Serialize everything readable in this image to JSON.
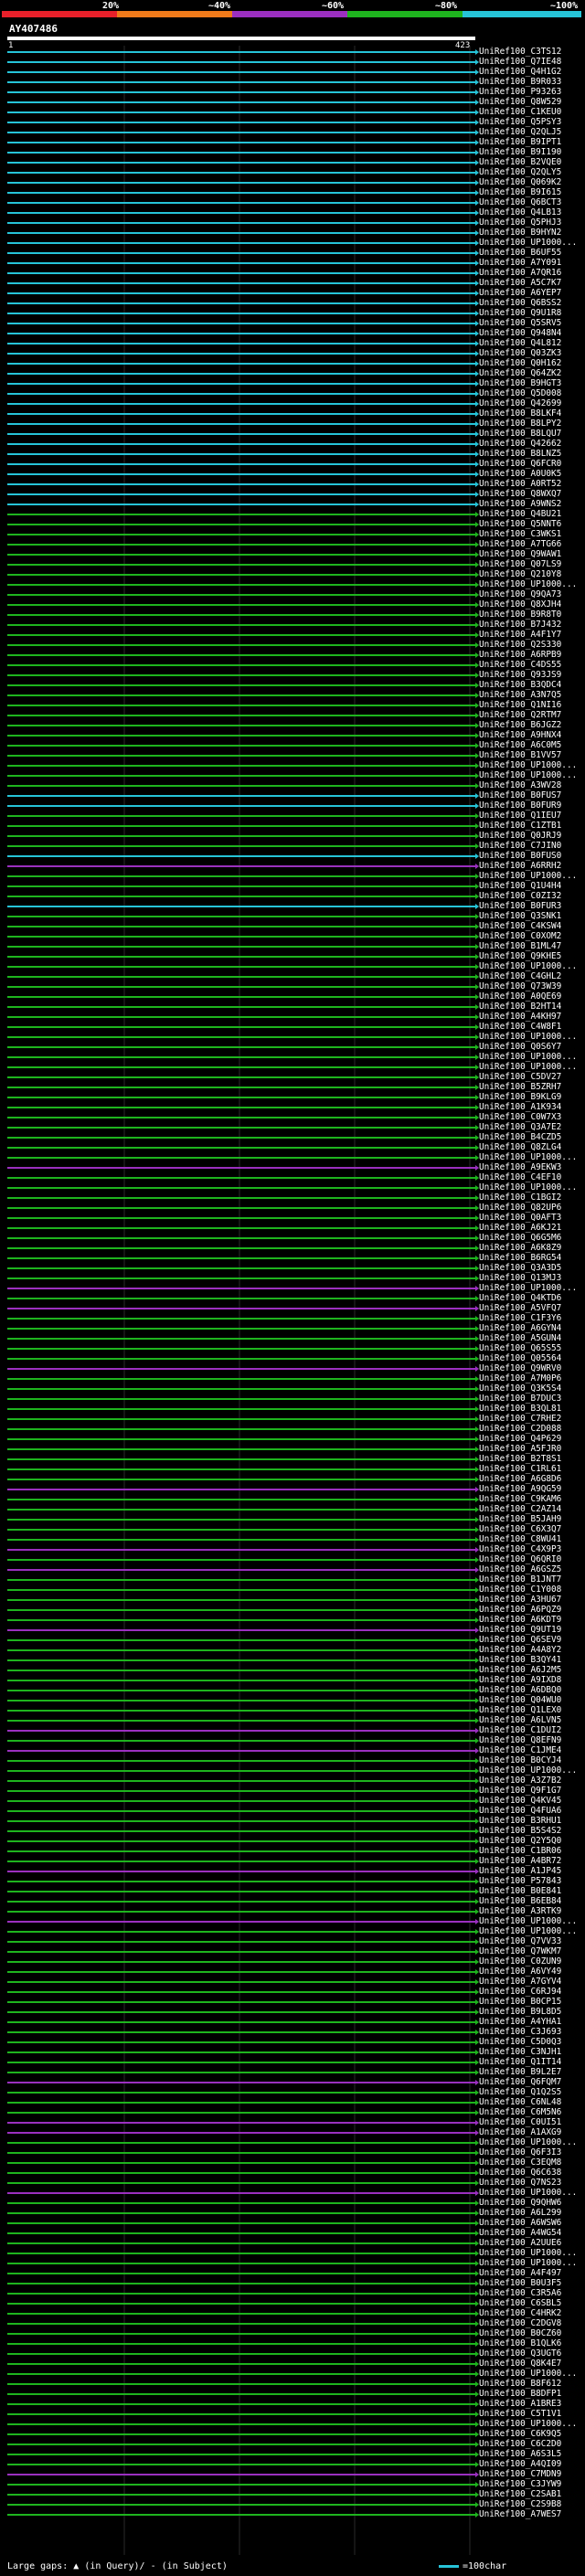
{
  "legend": {
    "stops": [
      {
        "label": "20%",
        "color": "#e8202a"
      },
      {
        "label": "~40%",
        "color": "#f07a1a"
      },
      {
        "label": "~60%",
        "color": "#9b2fc0"
      },
      {
        "label": "~80%",
        "color": "#1eb41e"
      },
      {
        "label": "~100%",
        "color": "#26c4d8"
      }
    ]
  },
  "query": {
    "title": "AY407486",
    "start": "1",
    "end": "423"
  },
  "footer": {
    "large_gaps": "Large gaps:",
    "in_query": "(in Query)/",
    "in_subject": "- (in Subject)",
    "scale": "=100char"
  },
  "hits": [
    {
      "label": "UniRef100_C3TS12",
      "color": "#26c4d8"
    },
    {
      "label": "UniRef100_Q7IE48",
      "color": "#26c4d8"
    },
    {
      "label": "UniRef100_Q4H1G2",
      "color": "#26c4d8"
    },
    {
      "label": "UniRef100_B9R033",
      "color": "#26c4d8"
    },
    {
      "label": "UniRef100_P93263",
      "color": "#26c4d8"
    },
    {
      "label": "UniRef100_Q8W529",
      "color": "#26c4d8"
    },
    {
      "label": "UniRef100_C1KEU0",
      "color": "#26c4d8"
    },
    {
      "label": "UniRef100_Q5PSY3",
      "color": "#26c4d8"
    },
    {
      "label": "UniRef100_Q2QLJ5",
      "color": "#26c4d8"
    },
    {
      "label": "UniRef100_B9IPT1",
      "color": "#26c4d8"
    },
    {
      "label": "UniRef100_B9I190",
      "color": "#26c4d8"
    },
    {
      "label": "UniRef100_B2VQE0",
      "color": "#26c4d8"
    },
    {
      "label": "UniRef100_Q2QLY5",
      "color": "#26c4d8"
    },
    {
      "label": "UniRef100_Q069K2",
      "color": "#26c4d8"
    },
    {
      "label": "UniRef100_B9I615",
      "color": "#26c4d8"
    },
    {
      "label": "UniRef100_Q6BCT3",
      "color": "#26c4d8"
    },
    {
      "label": "UniRef100_Q4LB13",
      "color": "#26c4d8"
    },
    {
      "label": "UniRef100_Q5PHJ3",
      "color": "#26c4d8"
    },
    {
      "label": "UniRef100_B9HYN2",
      "color": "#26c4d8"
    },
    {
      "label": "UniRef100_UP1000...",
      "color": "#26c4d8"
    },
    {
      "label": "UniRef100_B6UF55",
      "color": "#26c4d8"
    },
    {
      "label": "UniRef100_A7Y091",
      "color": "#26c4d8"
    },
    {
      "label": "UniRef100_A7QR16",
      "color": "#26c4d8"
    },
    {
      "label": "UniRef100_A5C7K7",
      "color": "#26c4d8"
    },
    {
      "label": "UniRef100_A6YEP7",
      "color": "#26c4d8"
    },
    {
      "label": "UniRef100_Q6BSS2",
      "color": "#26c4d8"
    },
    {
      "label": "UniRef100_Q9U1R8",
      "color": "#26c4d8"
    },
    {
      "label": "UniRef100_Q5SRV5",
      "color": "#26c4d8"
    },
    {
      "label": "UniRef100_Q948N4",
      "color": "#26c4d8"
    },
    {
      "label": "UniRef100_Q4L812",
      "color": "#26c4d8"
    },
    {
      "label": "UniRef100_Q03ZK3",
      "color": "#26c4d8"
    },
    {
      "label": "UniRef100_Q0H162",
      "color": "#26c4d8"
    },
    {
      "label": "UniRef100_Q64ZK2",
      "color": "#26c4d8"
    },
    {
      "label": "UniRef100_B9HGT3",
      "color": "#26c4d8"
    },
    {
      "label": "UniRef100_Q5D008",
      "color": "#26c4d8"
    },
    {
      "label": "UniRef100_Q42699",
      "color": "#26c4d8"
    },
    {
      "label": "UniRef100_B8LKF4",
      "color": "#26c4d8"
    },
    {
      "label": "UniRef100_B8LPY2",
      "color": "#26c4d8"
    },
    {
      "label": "UniRef100_B8LQU7",
      "color": "#26c4d8"
    },
    {
      "label": "UniRef100_Q42662",
      "color": "#26c4d8"
    },
    {
      "label": "UniRef100_B8LNZ5",
      "color": "#26c4d8"
    },
    {
      "label": "UniRef100_Q6FCR0",
      "color": "#26c4d8"
    },
    {
      "label": "UniRef100_A0U0K5",
      "color": "#26c4d8"
    },
    {
      "label": "UniRef100_A0RT52",
      "color": "#26c4d8"
    },
    {
      "label": "UniRef100_Q8WXQ7",
      "color": "#26c4d8"
    },
    {
      "label": "UniRef100_A9WNS2",
      "color": "#26c4d8"
    },
    {
      "label": "UniRef100_Q4BU21",
      "color": "#1eb41e"
    },
    {
      "label": "UniRef100_Q5NNT6",
      "color": "#1eb41e"
    },
    {
      "label": "UniRef100_C3WKS1",
      "color": "#1eb41e"
    },
    {
      "label": "UniRef100_A7TG66",
      "color": "#1eb41e"
    },
    {
      "label": "UniRef100_Q9WAW1",
      "color": "#1eb41e"
    },
    {
      "label": "UniRef100_Q07LS9",
      "color": "#1eb41e"
    },
    {
      "label": "UniRef100_Q210Y8",
      "color": "#1eb41e"
    },
    {
      "label": "UniRef100_UP1000...",
      "color": "#1eb41e"
    },
    {
      "label": "UniRef100_Q9QA73",
      "color": "#1eb41e"
    },
    {
      "label": "UniRef100_Q8XJH4",
      "color": "#1eb41e"
    },
    {
      "label": "UniRef100_B9R8T0",
      "color": "#1eb41e"
    },
    {
      "label": "UniRef100_B7J432",
      "color": "#1eb41e"
    },
    {
      "label": "UniRef100_A4F1Y7",
      "color": "#1eb41e"
    },
    {
      "label": "UniRef100_Q2S330",
      "color": "#1eb41e"
    },
    {
      "label": "UniRef100_A6RPB9",
      "color": "#1eb41e"
    },
    {
      "label": "UniRef100_C4DS55",
      "color": "#1eb41e"
    },
    {
      "label": "UniRef100_Q93JS9",
      "color": "#1eb41e"
    },
    {
      "label": "UniRef100_B3QDC4",
      "color": "#1eb41e"
    },
    {
      "label": "UniRef100_A3N7Q5",
      "color": "#1eb41e"
    },
    {
      "label": "UniRef100_Q1NI16",
      "color": "#1eb41e"
    },
    {
      "label": "UniRef100_Q2RTM7",
      "color": "#1eb41e"
    },
    {
      "label": "UniRef100_B6JGZ2",
      "color": "#1eb41e"
    },
    {
      "label": "UniRef100_A9HNX4",
      "color": "#1eb41e"
    },
    {
      "label": "UniRef100_A6C0M5",
      "color": "#1eb41e"
    },
    {
      "label": "UniRef100_B1VV57",
      "color": "#1eb41e"
    },
    {
      "label": "UniRef100_UP1000...",
      "color": "#1eb41e"
    },
    {
      "label": "UniRef100_UP1000...",
      "color": "#1eb41e"
    },
    {
      "label": "UniRef100_A3WV28",
      "color": "#1eb41e"
    },
    {
      "label": "UniRef100_B0FUS7",
      "color": "#26c4d8"
    },
    {
      "label": "UniRef100_B0FUR9",
      "color": "#26c4d8"
    },
    {
      "label": "UniRef100_Q1IEU7",
      "color": "#1eb41e"
    },
    {
      "label": "UniRef100_C1ZTB1",
      "color": "#1eb41e"
    },
    {
      "label": "UniRef100_Q0JRJ9",
      "color": "#1eb41e"
    },
    {
      "label": "UniRef100_C7JIN0",
      "color": "#1eb41e"
    },
    {
      "label": "UniRef100_B0FUS0",
      "color": "#26c4d8"
    },
    {
      "label": "UniRef100_A6RRH2",
      "color": "#9b2fc0"
    },
    {
      "label": "UniRef100_UP1000...",
      "color": "#1eb41e"
    },
    {
      "label": "UniRef100_Q1U4H4",
      "color": "#1eb41e"
    },
    {
      "label": "UniRef100_C0ZI32",
      "color": "#1eb41e"
    },
    {
      "label": "UniRef100_B0FUR3",
      "color": "#26c4d8"
    },
    {
      "label": "UniRef100_Q3SNK1",
      "color": "#1eb41e"
    },
    {
      "label": "UniRef100_C4KSW4",
      "color": "#1eb41e"
    },
    {
      "label": "UniRef100_C0XOM2",
      "color": "#1eb41e"
    },
    {
      "label": "UniRef100_B1ML47",
      "color": "#1eb41e"
    },
    {
      "label": "UniRef100_Q9KHE5",
      "color": "#1eb41e"
    },
    {
      "label": "UniRef100_UP1000...",
      "color": "#1eb41e"
    },
    {
      "label": "UniRef100_C4GHL2",
      "color": "#1eb41e"
    },
    {
      "label": "UniRef100_Q73W39",
      "color": "#1eb41e"
    },
    {
      "label": "UniRef100_A0QE69",
      "color": "#1eb41e"
    },
    {
      "label": "UniRef100_B2HT14",
      "color": "#1eb41e"
    },
    {
      "label": "UniRef100_A4KH97",
      "color": "#1eb41e"
    },
    {
      "label": "UniRef100_C4W8F1",
      "color": "#1eb41e"
    },
    {
      "label": "UniRef100_UP1000...",
      "color": "#1eb41e"
    },
    {
      "label": "UniRef100_Q0S6Y7",
      "color": "#1eb41e"
    },
    {
      "label": "UniRef100_UP1000...",
      "color": "#1eb41e"
    },
    {
      "label": "UniRef100_UP1000...",
      "color": "#1eb41e"
    },
    {
      "label": "UniRef100_C5DV27",
      "color": "#1eb41e"
    },
    {
      "label": "UniRef100_B5ZRH7",
      "color": "#1eb41e"
    },
    {
      "label": "UniRef100_B9KLG9",
      "color": "#1eb41e"
    },
    {
      "label": "UniRef100_A1K934",
      "color": "#1eb41e"
    },
    {
      "label": "UniRef100_C0W7X3",
      "color": "#1eb41e"
    },
    {
      "label": "UniRef100_Q3A7E2",
      "color": "#1eb41e"
    },
    {
      "label": "UniRef100_B4CZD5",
      "color": "#1eb41e"
    },
    {
      "label": "UniRef100_Q8ZLG4",
      "color": "#1eb41e"
    },
    {
      "label": "UniRef100_UP1000...",
      "color": "#1eb41e"
    },
    {
      "label": "UniRef100_A9EKW3",
      "color": "#9b2fc0"
    },
    {
      "label": "UniRef100_C4EF10",
      "color": "#1eb41e"
    },
    {
      "label": "UniRef100_UP1000...",
      "color": "#1eb41e"
    },
    {
      "label": "UniRef100_C1BGI2",
      "color": "#1eb41e"
    },
    {
      "label": "UniRef100_Q82UP6",
      "color": "#1eb41e"
    },
    {
      "label": "UniRef100_Q0AFT3",
      "color": "#1eb41e"
    },
    {
      "label": "UniRef100_A6KJ21",
      "color": "#1eb41e"
    },
    {
      "label": "UniRef100_Q6G5M6",
      "color": "#1eb41e"
    },
    {
      "label": "UniRef100_A6K8Z9",
      "color": "#1eb41e"
    },
    {
      "label": "UniRef100_B6RG54",
      "color": "#1eb41e"
    },
    {
      "label": "UniRef100_Q3A3D5",
      "color": "#1eb41e"
    },
    {
      "label": "UniRef100_Q13MJ3",
      "color": "#1eb41e"
    },
    {
      "label": "UniRef100_UP1000...",
      "color": "#9b2fc0"
    },
    {
      "label": "UniRef100_Q4KTD6",
      "color": "#1eb41e"
    },
    {
      "label": "UniRef100_A5VFQ7",
      "color": "#9b2fc0"
    },
    {
      "label": "UniRef100_C1F3Y6",
      "color": "#1eb41e"
    },
    {
      "label": "UniRef100_A6GYN4",
      "color": "#1eb41e"
    },
    {
      "label": "UniRef100_A5GUN4",
      "color": "#1eb41e"
    },
    {
      "label": "UniRef100_Q65S55",
      "color": "#1eb41e"
    },
    {
      "label": "UniRef100_Q05564",
      "color": "#1eb41e"
    },
    {
      "label": "UniRef100_Q9WRV0",
      "color": "#9b2fc0"
    },
    {
      "label": "UniRef100_A7M0P6",
      "color": "#1eb41e"
    },
    {
      "label": "UniRef100_Q3K5S4",
      "color": "#1eb41e"
    },
    {
      "label": "UniRef100_B7DUC3",
      "color": "#1eb41e"
    },
    {
      "label": "UniRef100_B3QL81",
      "color": "#1eb41e"
    },
    {
      "label": "UniRef100_C7RHE2",
      "color": "#1eb41e"
    },
    {
      "label": "UniRef100_C2D088",
      "color": "#1eb41e"
    },
    {
      "label": "UniRef100_Q4P629",
      "color": "#1eb41e"
    },
    {
      "label": "UniRef100_A5FJR0",
      "color": "#1eb41e"
    },
    {
      "label": "UniRef100_B2T8S1",
      "color": "#1eb41e"
    },
    {
      "label": "UniRef100_C1RL61",
      "color": "#1eb41e"
    },
    {
      "label": "UniRef100_A6G8D6",
      "color": "#1eb41e"
    },
    {
      "label": "UniRef100_A9QG59",
      "color": "#9b2fc0"
    },
    {
      "label": "UniRef100_C9KAM6",
      "color": "#1eb41e"
    },
    {
      "label": "UniRef100_C2AZ14",
      "color": "#1eb41e"
    },
    {
      "label": "UniRef100_B5JAH9",
      "color": "#1eb41e"
    },
    {
      "label": "UniRef100_C6X3Q7",
      "color": "#1eb41e"
    },
    {
      "label": "UniRef100_C8WU41",
      "color": "#1eb41e"
    },
    {
      "label": "UniRef100_C4X9P3",
      "color": "#9b2fc0"
    },
    {
      "label": "UniRef100_Q6QRI0",
      "color": "#1eb41e"
    },
    {
      "label": "UniRef100_A6GSZ5",
      "color": "#9b2fc0"
    },
    {
      "label": "UniRef100_B1JNT7",
      "color": "#1eb41e"
    },
    {
      "label": "UniRef100_C1Y008",
      "color": "#1eb41e"
    },
    {
      "label": "UniRef100_A3HU67",
      "color": "#1eb41e"
    },
    {
      "label": "UniRef100_A6PQZ9",
      "color": "#1eb41e"
    },
    {
      "label": "UniRef100_A6KDT9",
      "color": "#1eb41e"
    },
    {
      "label": "UniRef100_Q9UT19",
      "color": "#9b2fc0"
    },
    {
      "label": "UniRef100_Q6SEV9",
      "color": "#1eb41e"
    },
    {
      "label": "UniRef100_A4A8Y2",
      "color": "#1eb41e"
    },
    {
      "label": "UniRef100_B3QY41",
      "color": "#1eb41e"
    },
    {
      "label": "UniRef100_A6J2M5",
      "color": "#1eb41e"
    },
    {
      "label": "UniRef100_A9IXD8",
      "color": "#1eb41e"
    },
    {
      "label": "UniRef100_A6DBQ0",
      "color": "#1eb41e"
    },
    {
      "label": "UniRef100_Q04WU0",
      "color": "#1eb41e"
    },
    {
      "label": "UniRef100_Q1LEX0",
      "color": "#1eb41e"
    },
    {
      "label": "UniRef100_A6LVN5",
      "color": "#1eb41e"
    },
    {
      "label": "UniRef100_C1DUI2",
      "color": "#9b2fc0"
    },
    {
      "label": "UniRef100_Q8EFN9",
      "color": "#1eb41e"
    },
    {
      "label": "UniRef100_C1JME4",
      "color": "#9b2fc0"
    },
    {
      "label": "UniRef100_B0CYJ4",
      "color": "#1eb41e"
    },
    {
      "label": "UniRef100_UP1000...",
      "color": "#1eb41e"
    },
    {
      "label": "UniRef100_A3Z7B2",
      "color": "#1eb41e"
    },
    {
      "label": "UniRef100_Q9F1G7",
      "color": "#1eb41e"
    },
    {
      "label": "UniRef100_Q4KV45",
      "color": "#1eb41e"
    },
    {
      "label": "UniRef100_Q4FUA6",
      "color": "#1eb41e"
    },
    {
      "label": "UniRef100_B3RHU1",
      "color": "#1eb41e"
    },
    {
      "label": "UniRef100_B5S4S2",
      "color": "#1eb41e"
    },
    {
      "label": "UniRef100_Q2Y5Q0",
      "color": "#1eb41e"
    },
    {
      "label": "UniRef100_C1BR06",
      "color": "#1eb41e"
    },
    {
      "label": "UniRef100_A4BR72",
      "color": "#1eb41e"
    },
    {
      "label": "UniRef100_A1JP45",
      "color": "#9b2fc0"
    },
    {
      "label": "UniRef100_P57843",
      "color": "#1eb41e"
    },
    {
      "label": "UniRef100_B0E841",
      "color": "#1eb41e"
    },
    {
      "label": "UniRef100_B6EB84",
      "color": "#1eb41e"
    },
    {
      "label": "UniRef100_A3RTK9",
      "color": "#1eb41e"
    },
    {
      "label": "UniRef100_UP1000...",
      "color": "#9b2fc0"
    },
    {
      "label": "UniRef100_UP1000...",
      "color": "#1eb41e"
    },
    {
      "label": "UniRef100_Q7VV33",
      "color": "#1eb41e"
    },
    {
      "label": "UniRef100_Q7WKM7",
      "color": "#1eb41e"
    },
    {
      "label": "UniRef100_C0ZUN9",
      "color": "#1eb41e"
    },
    {
      "label": "UniRef100_A6VY49",
      "color": "#1eb41e"
    },
    {
      "label": "UniRef100_A7GYV4",
      "color": "#1eb41e"
    },
    {
      "label": "UniRef100_C6RJ94",
      "color": "#1eb41e"
    },
    {
      "label": "UniRef100_B0CP15",
      "color": "#1eb41e"
    },
    {
      "label": "UniRef100_B9L8D5",
      "color": "#1eb41e"
    },
    {
      "label": "UniRef100_A4YHA1",
      "color": "#1eb41e"
    },
    {
      "label": "UniRef100_C3J693",
      "color": "#1eb41e"
    },
    {
      "label": "UniRef100_C5D0Q3",
      "color": "#1eb41e"
    },
    {
      "label": "UniRef100_C3NJH1",
      "color": "#1eb41e"
    },
    {
      "label": "UniRef100_Q1IT14",
      "color": "#1eb41e"
    },
    {
      "label": "UniRef100_B9L2E7",
      "color": "#1eb41e"
    },
    {
      "label": "UniRef100_Q6FQM7",
      "color": "#9b2fc0"
    },
    {
      "label": "UniRef100_Q1Q2S5",
      "color": "#1eb41e"
    },
    {
      "label": "UniRef100_C6NL48",
      "color": "#1eb41e"
    },
    {
      "label": "UniRef100_C6M5N6",
      "color": "#1eb41e"
    },
    {
      "label": "UniRef100_C0UI51",
      "color": "#9b2fc0"
    },
    {
      "label": "UniRef100_A1AXG9",
      "color": "#9b2fc0"
    },
    {
      "label": "UniRef100_UP1000...",
      "color": "#1eb41e"
    },
    {
      "label": "UniRef100_Q6F3I3",
      "color": "#1eb41e"
    },
    {
      "label": "UniRef100_C3EQM8",
      "color": "#1eb41e"
    },
    {
      "label": "UniRef100_Q6C638",
      "color": "#1eb41e"
    },
    {
      "label": "UniRef100_Q7NS23",
      "color": "#1eb41e"
    },
    {
      "label": "UniRef100_UP1000...",
      "color": "#9b2fc0"
    },
    {
      "label": "UniRef100_Q9QHW6",
      "color": "#1eb41e"
    },
    {
      "label": "UniRef100_A6L299",
      "color": "#1eb41e"
    },
    {
      "label": "UniRef100_A6WSW6",
      "color": "#1eb41e"
    },
    {
      "label": "UniRef100_A4WG54",
      "color": "#1eb41e"
    },
    {
      "label": "UniRef100_A2UUE6",
      "color": "#1eb41e"
    },
    {
      "label": "UniRef100_UP1000...",
      "color": "#1eb41e"
    },
    {
      "label": "UniRef100_UP1000...",
      "color": "#1eb41e"
    },
    {
      "label": "UniRef100_A4F497",
      "color": "#1eb41e"
    },
    {
      "label": "UniRef100_B0U3F5",
      "color": "#1eb41e"
    },
    {
      "label": "UniRef100_C3R5A6",
      "color": "#1eb41e"
    },
    {
      "label": "UniRef100_C6SBL5",
      "color": "#1eb41e"
    },
    {
      "label": "UniRef100_C4HRK2",
      "color": "#1eb41e"
    },
    {
      "label": "UniRef100_C2DGV8",
      "color": "#1eb41e"
    },
    {
      "label": "UniRef100_B0CZ60",
      "color": "#1eb41e"
    },
    {
      "label": "UniRef100_B1QLK6",
      "color": "#1eb41e"
    },
    {
      "label": "UniRef100_Q3UGT6",
      "color": "#1eb41e"
    },
    {
      "label": "UniRef100_Q8K4E7",
      "color": "#1eb41e"
    },
    {
      "label": "UniRef100_UP1000...",
      "color": "#1eb41e"
    },
    {
      "label": "UniRef100_B8F612",
      "color": "#1eb41e"
    },
    {
      "label": "UniRef100_B8DFP1",
      "color": "#1eb41e"
    },
    {
      "label": "UniRef100_A1BRE3",
      "color": "#1eb41e"
    },
    {
      "label": "UniRef100_C5T1V1",
      "color": "#1eb41e"
    },
    {
      "label": "UniRef100_UP1000...",
      "color": "#1eb41e"
    },
    {
      "label": "UniRef100_C6K9Q5",
      "color": "#1eb41e"
    },
    {
      "label": "UniRef100_C6C2D0",
      "color": "#1eb41e"
    },
    {
      "label": "UniRef100_A6S3L5",
      "color": "#1eb41e"
    },
    {
      "label": "UniRef100_A4QI09",
      "color": "#1eb41e"
    },
    {
      "label": "UniRef100_C7MDN9",
      "color": "#9b2fc0"
    },
    {
      "label": "UniRef100_C3JYW9",
      "color": "#1eb41e"
    },
    {
      "label": "UniRef100_C2SAB1",
      "color": "#1eb41e"
    },
    {
      "label": "UniRef100_C2S9B8",
      "color": "#1eb41e"
    },
    {
      "label": "UniRef100_A7WES7",
      "color": "#1eb41e"
    }
  ]
}
